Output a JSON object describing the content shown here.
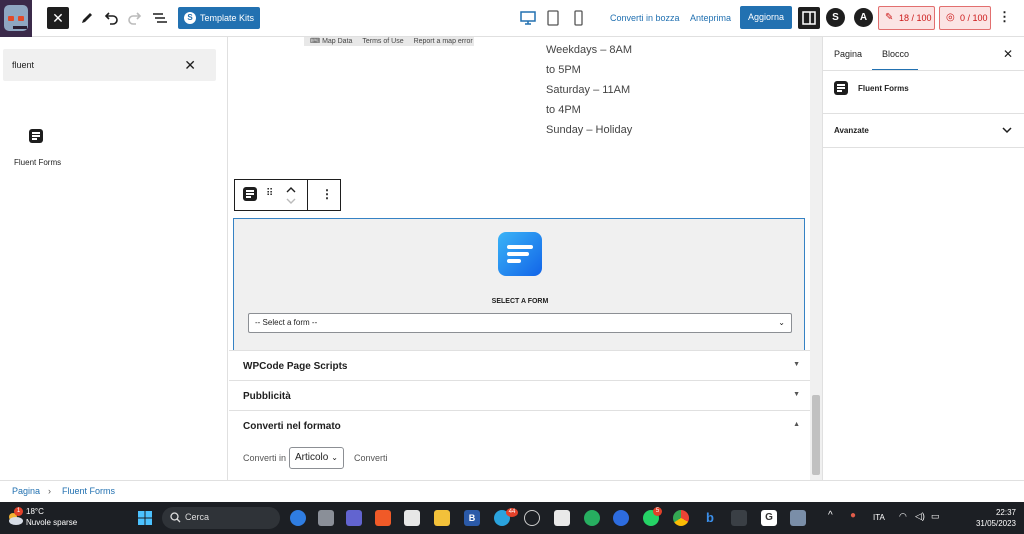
{
  "topbar": {
    "template_kits": "Template Kits",
    "switch_to_draft": "Converti in bozza",
    "preview": "Anteprima",
    "update": "Aggiorna",
    "score1": "18 / 100",
    "score2": "0 / 100",
    "close_glyph": "✕",
    "kebab": "⋮"
  },
  "inserter": {
    "search_value": "fluent",
    "clear_glyph": "✕",
    "result_label": "Fluent Forms"
  },
  "canvas": {
    "map_attrib": [
      "Map Data",
      "Terms of Use",
      "Report a map error"
    ],
    "hours": [
      "Weekdays – 8AM",
      "to 5PM",
      "Saturday – 11AM",
      "to 4PM",
      "Sunday – Holiday"
    ],
    "select_label": "SELECT A FORM",
    "select_value": "-- Select a form --"
  },
  "meta": {
    "rows": [
      {
        "title": "WPCode Page Scripts",
        "arrow": "▼"
      },
      {
        "title": "Pubblicità",
        "arrow": "▼"
      },
      {
        "title": "Converti nel formato",
        "arrow": "▲"
      }
    ],
    "convert_in": "Converti in",
    "format_value": "Articolo",
    "convert_button": "Converti"
  },
  "sidebar": {
    "tab_page": "Pagina",
    "tab_block": "Blocco",
    "close_glyph": "✕",
    "block_name": "Fluent Forms",
    "advanced": "Avanzate"
  },
  "breadcrumb": {
    "root": "Pagina",
    "sep": "›",
    "current": "Fluent Forms"
  },
  "taskbar": {
    "temp": "18°C",
    "weather": "Nuvole sparse",
    "search": "Cerca",
    "lang": "ITA",
    "time": "22:37",
    "date": "31/05/2023",
    "weather_badge": "1",
    "telegram_badge": "44",
    "whatsapp_badge": "5"
  },
  "colors": {
    "accent": "#2271b1",
    "score_red": "#cc1818",
    "taskbar": "#1c1f24"
  }
}
